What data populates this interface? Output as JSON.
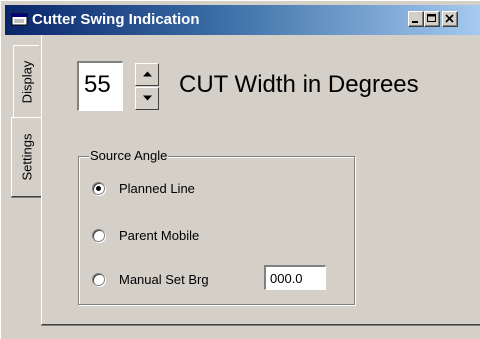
{
  "window": {
    "title": "Cutter Swing Indication",
    "icon": "app-window-icon",
    "controls": {
      "minimize_icon": "minimize-icon",
      "maximize_icon": "maximize-icon",
      "close_icon": "close-icon"
    }
  },
  "tabs": [
    {
      "label": "Display",
      "active": false
    },
    {
      "label": "Settings",
      "active": true
    }
  ],
  "cut_width": {
    "value": "55",
    "label": "CUT Width in Degrees",
    "up_icon": "spin-up-arrow-icon",
    "down_icon": "spin-down-arrow-icon"
  },
  "source_angle": {
    "legend": "Source Angle",
    "options": [
      {
        "label": "Planned Line",
        "checked": true
      },
      {
        "label": "Parent Mobile",
        "checked": false
      },
      {
        "label": "Manual Set Brg",
        "checked": false
      }
    ],
    "manual_bearing_value": "000.0"
  },
  "colors": {
    "title_gradient_start": "#0a246a",
    "title_gradient_end": "#a6caf0",
    "face": "#d4d0c8"
  }
}
